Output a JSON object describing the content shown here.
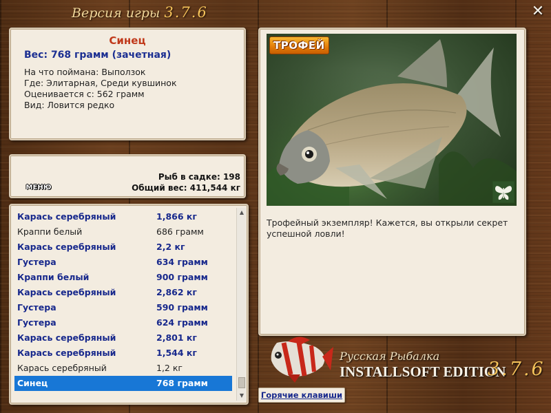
{
  "title": {
    "label": "Версия игры",
    "version": "3.7.6"
  },
  "catch": {
    "name": "Синец",
    "weight": "Вес: 768 грамм (зачетная)",
    "details": [
      "На что поймана: Выползок",
      "Где: Элитарная, Среди кувшинок",
      "Оценивается с: 562 грамм",
      "Вид: Ловится редко"
    ]
  },
  "keepnet": {
    "menu_label": "МЕНЮ",
    "fish_count": "Рыб в садке: 198",
    "total_weight": "Общий вес: 411,544 кг"
  },
  "list": [
    {
      "name": "Карась серебряный",
      "weight": "1,866 кг",
      "style": "bold"
    },
    {
      "name": "Краппи белый",
      "weight": "686 грамм",
      "style": "plain"
    },
    {
      "name": "Карась серебряный",
      "weight": "2,2 кг",
      "style": "bold"
    },
    {
      "name": "Густера",
      "weight": "634 грамм",
      "style": "bold"
    },
    {
      "name": "Краппи белый",
      "weight": "900 грамм",
      "style": "bold"
    },
    {
      "name": "Карась серебряный",
      "weight": "2,862 кг",
      "style": "bold"
    },
    {
      "name": "Густера",
      "weight": "590 грамм",
      "style": "bold"
    },
    {
      "name": "Густера",
      "weight": "624 грамм",
      "style": "bold"
    },
    {
      "name": "Карась серебряный",
      "weight": "2,801 кг",
      "style": "bold"
    },
    {
      "name": "Карась серебряный",
      "weight": "1,544 кг",
      "style": "bold"
    },
    {
      "name": "Карась серебряный",
      "weight": "1,2 кг",
      "style": "plain"
    },
    {
      "name": "Синец",
      "weight": "768 грамм",
      "style": "selected"
    }
  ],
  "scroll": {
    "up_icon": "▲",
    "down_icon": "▼"
  },
  "photo": {
    "badge": "ТРОФЕЙ",
    "description": "Трофейный экземпляр! Кажется, вы открыли секрет успешной ловли!"
  },
  "logo": {
    "line1": "Русская Рыбалка",
    "line2": "INSTALLSOFT EDITION",
    "version": "3.7.6"
  },
  "hotkeys_label": "Горячие клавиши",
  "close_icon": "✕"
}
